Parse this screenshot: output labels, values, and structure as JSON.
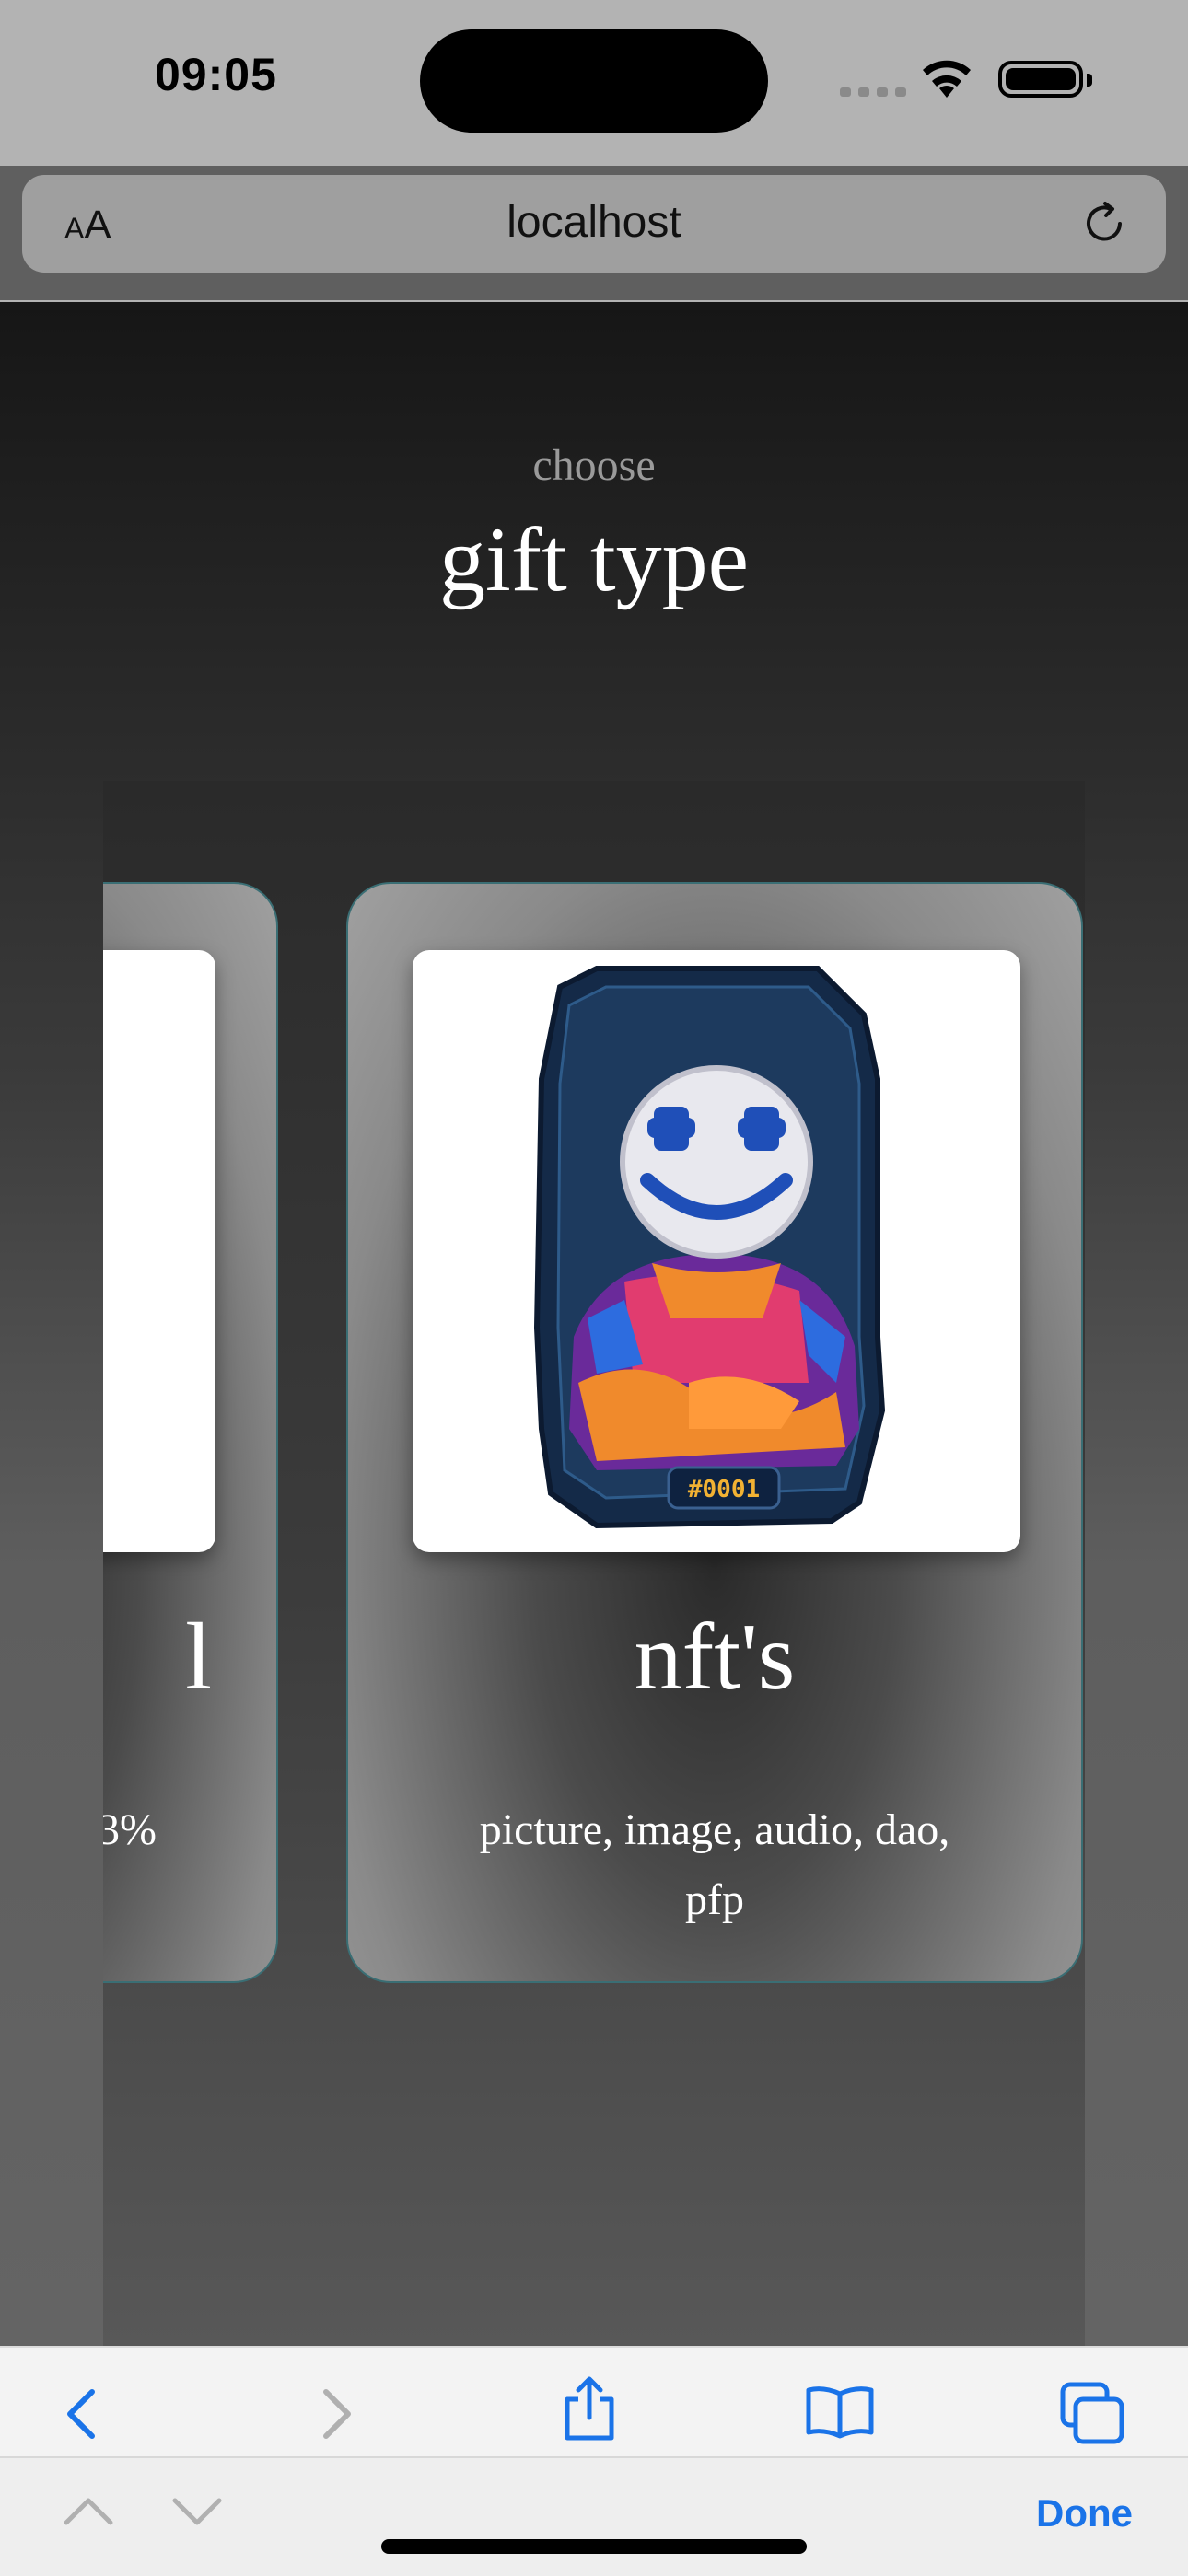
{
  "status_bar": {
    "time": "09:05"
  },
  "browser": {
    "text_size_label_small": "A",
    "text_size_label_large": "A",
    "url": "localhost"
  },
  "page": {
    "eyebrow": "choose",
    "title": "gift type",
    "cards": [
      {
        "title": "l",
        "description": "3%"
      },
      {
        "title": "nft's",
        "description": "picture, image, audio, dao, pfp",
        "image_badge": "#0001"
      }
    ]
  },
  "find_bar": {
    "done_label": "Done"
  },
  "colors": {
    "accent": "#1a73e8",
    "card_border": "#3a6e74"
  }
}
